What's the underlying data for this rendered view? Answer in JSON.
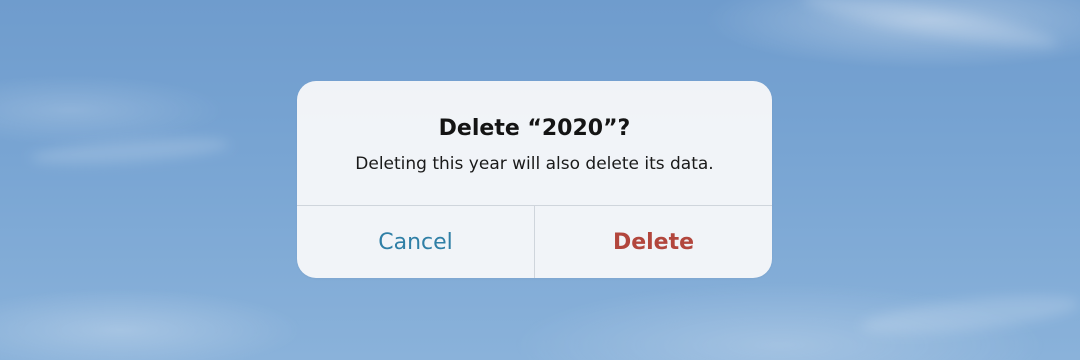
{
  "alert": {
    "title": "Delete “2020”?",
    "message": "Deleting this year will also delete its data.",
    "buttons": {
      "cancel_label": "Cancel",
      "delete_label": "Delete"
    }
  },
  "colors": {
    "cancel_text": "#2f7fa6",
    "delete_text": "#b2463d",
    "alert_background": "#f6f7f9",
    "sky_background": "#79a5d3"
  }
}
